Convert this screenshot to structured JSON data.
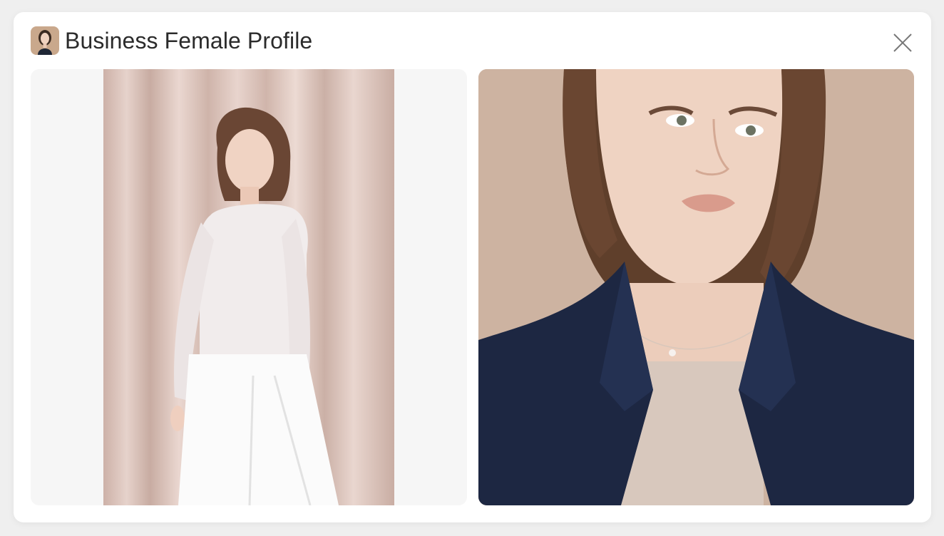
{
  "dialog": {
    "title": "Business Female Profile",
    "avatar_icon": "profile-avatar-icon",
    "close_icon": "close-icon"
  },
  "images": [
    {
      "name": "full-length-photo",
      "description_icon": "photo"
    },
    {
      "name": "portrait-photo",
      "description_icon": "photo"
    }
  ],
  "colors": {
    "background": "#efefef",
    "card": "#ffffff",
    "curtain": "#d9c2bb",
    "blazer": "#1f2b45",
    "hair": "#6e4a32",
    "skin": "#e9c8b3",
    "warm_backdrop": "#cdb3a1"
  }
}
